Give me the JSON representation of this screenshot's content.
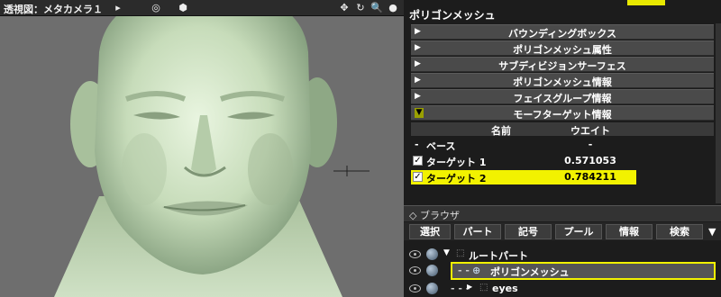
{
  "viewport": {
    "title": "透視図：メタカメラ１",
    "title_arrow": "▸",
    "icons": [
      "target-icon",
      "cube-icon",
      "move-icon",
      "rotate-icon",
      "zoom-icon",
      "sphere-icon"
    ]
  },
  "panel": {
    "title": "ポリゴンメッシュ",
    "sections": [
      {
        "label": "バウンディングボックス",
        "arrow": "▶",
        "open": false
      },
      {
        "label": "ポリゴンメッシュ属性",
        "arrow": "▶",
        "open": false
      },
      {
        "label": "サブディビジョンサーフェス",
        "arrow": "▶",
        "open": false
      },
      {
        "label": "ポリゴンメッシュ情報",
        "arrow": "▶",
        "open": false
      },
      {
        "label": "フェイスグループ情報",
        "arrow": "▶",
        "open": false
      },
      {
        "label": "モーフターゲット情報",
        "arrow": "▼",
        "open": true
      }
    ],
    "morph_table": {
      "columns": [
        "名前",
        "ウエイト"
      ],
      "rows": [
        {
          "prefix": "-",
          "name": "ベース",
          "weight": "-",
          "checked": null,
          "selected": false
        },
        {
          "prefix": "",
          "name": "ターゲット 1",
          "weight": "0.571053",
          "checked": true,
          "selected": false
        },
        {
          "prefix": "",
          "name": "ターゲット 2",
          "weight": "0.784211",
          "checked": true,
          "selected": true
        }
      ]
    }
  },
  "browser": {
    "title": "◇ ブラウザ",
    "tabs": [
      "選択",
      "パート",
      "記号",
      "プール",
      "情報",
      "検索"
    ],
    "more": "▼",
    "tree": [
      {
        "label": "ルートパート",
        "indent": 0
      },
      {
        "label": "ポリゴンメッシュ",
        "indent": 1,
        "highlighted": true
      },
      {
        "label": "eyes",
        "indent": 1
      }
    ]
  },
  "colors": {
    "highlight": "#f2f200",
    "panel_bg": "#1c1c1c",
    "viewport_bg": "#6e6e6e",
    "section_bg": "#4a4a4a"
  }
}
